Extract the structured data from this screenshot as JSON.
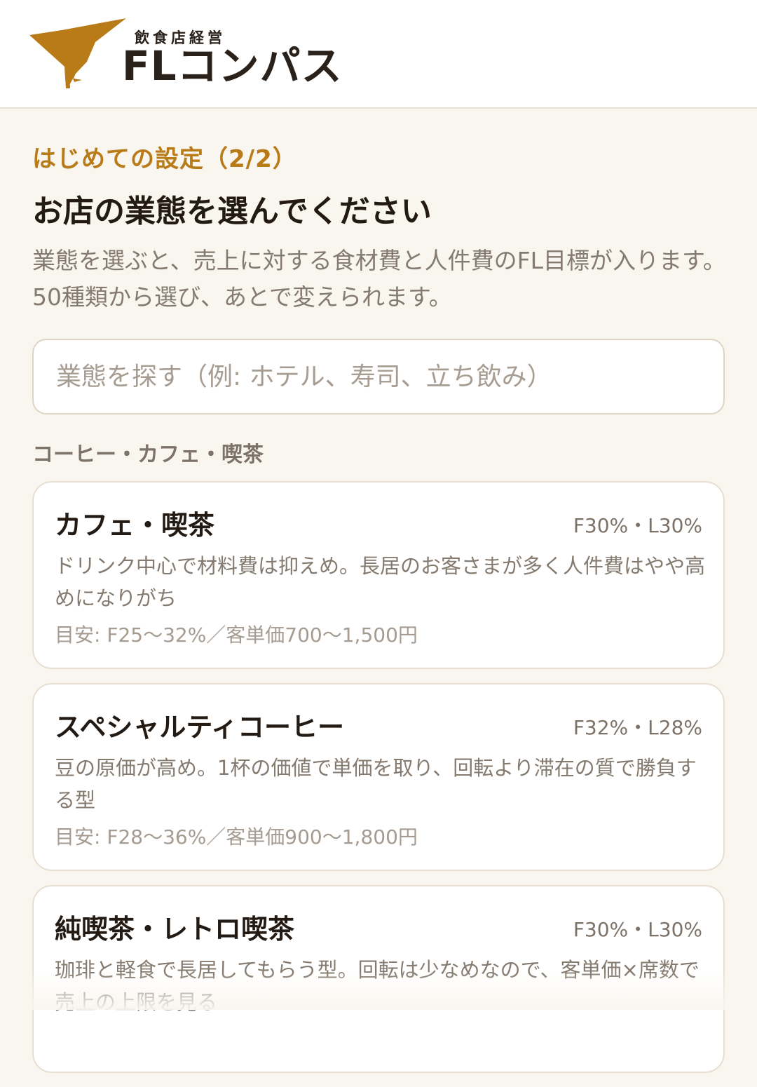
{
  "header": {
    "logo_subtitle": "飲食店経営",
    "logo_title": "FLコンパス",
    "brand_color": "#b97a18"
  },
  "setup": {
    "step_label": "はじめての設定（2/2）",
    "title": "お店の業態を選んでください",
    "description": "業態を選ぶと、売上に対する食材費と人件費のFL目標が入ります。50種類から選び、あとで変えられます。"
  },
  "search": {
    "placeholder": "業態を探す（例: ホテル、寿司、立ち飲み）",
    "value": ""
  },
  "category": {
    "label": "コーヒー・カフェ・喫茶",
    "items": [
      {
        "name": "カフェ・喫茶",
        "fl": "F30%・L30%",
        "description": "ドリンク中心で材料費は抑えめ。長居のお客さまが多く人件費はやや高めになりがち",
        "guide": "目安: F25〜32%／客単価700〜1,500円"
      },
      {
        "name": "スペシャルティコーヒー",
        "fl": "F32%・L28%",
        "description": "豆の原価が高め。1杯の価値で単価を取り、回転より滞在の質で勝負する型",
        "guide": "目安: F28〜36%／客単価900〜1,800円"
      },
      {
        "name": "純喫茶・レトロ喫茶",
        "fl": "F30%・L30%",
        "description": "珈琲と軽食で長居してもらう型。回転は少なめなので、客単価×席数で売上の上限を見る",
        "guide": ""
      }
    ]
  }
}
